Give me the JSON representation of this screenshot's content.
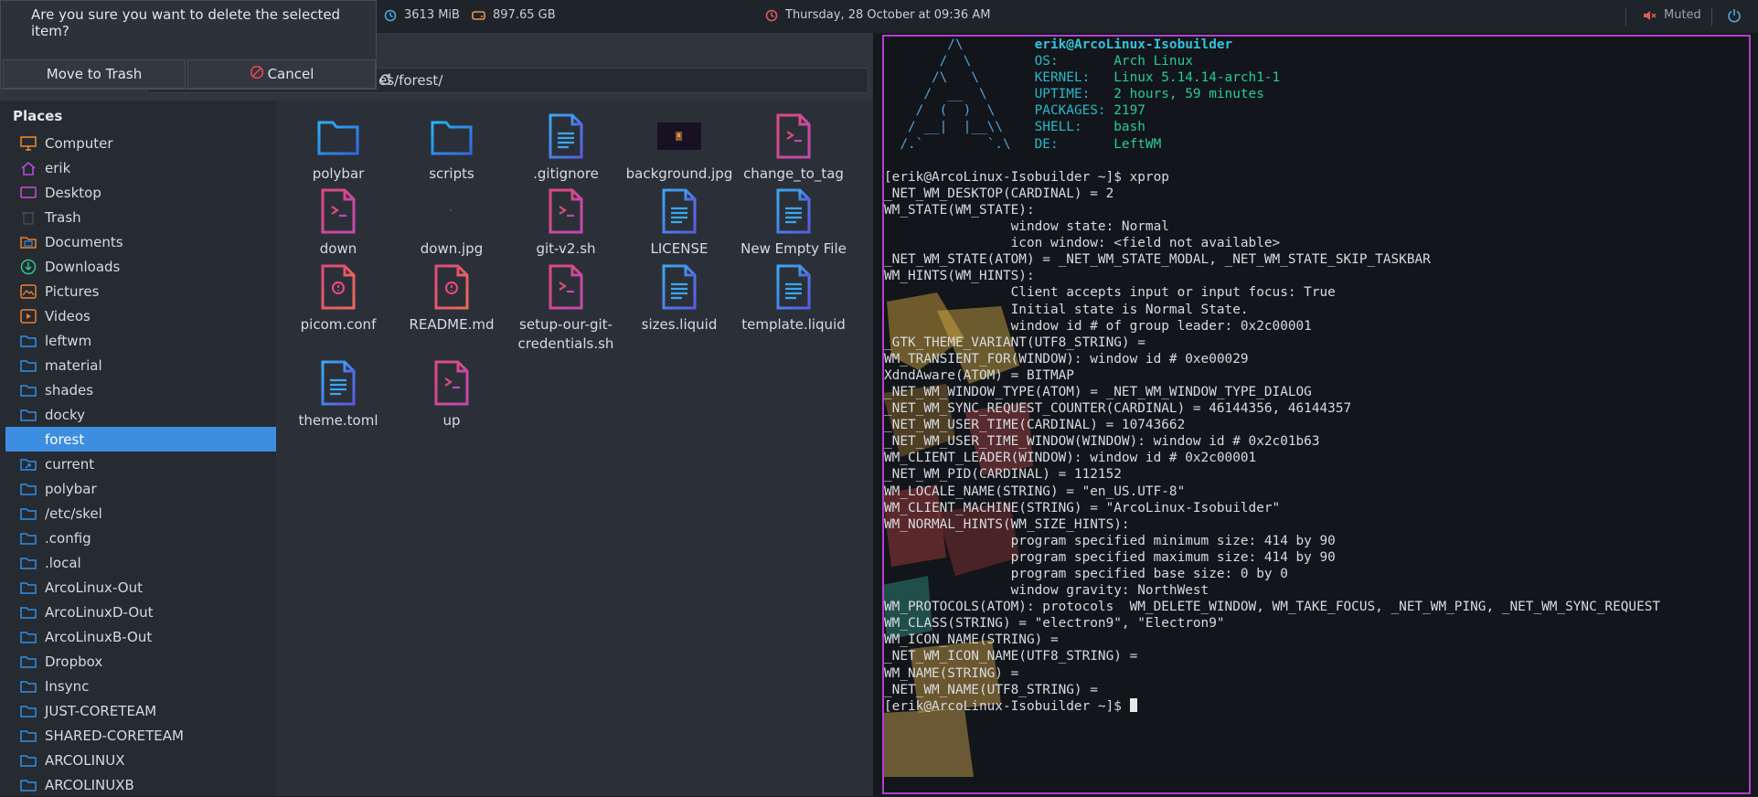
{
  "topbar": {
    "memory": "3613 MiB",
    "disk": "897.65 GB",
    "datetime": "Thursday, 28 October at 09:36 AM",
    "volume": "Muted",
    "colors": {
      "accent_red": "#e05a5a",
      "accent_blue": "#4fa6d8",
      "accent_orange": "#e8974a"
    }
  },
  "dialog": {
    "question": "Are you sure you want to delete the selected item?",
    "move_to_trash": "Move to Trash",
    "cancel": "Cancel"
  },
  "file_manager": {
    "path_visible": "es/forest/",
    "places_title": "Places",
    "places": [
      {
        "label": "Computer",
        "icon": "computer-icon"
      },
      {
        "label": "erik",
        "icon": "home-icon"
      },
      {
        "label": "Desktop",
        "icon": "desktop-icon"
      },
      {
        "label": "Trash",
        "icon": "trash-icon"
      },
      {
        "label": "Documents",
        "icon": "documents-icon"
      },
      {
        "label": "Downloads",
        "icon": "downloads-icon"
      },
      {
        "label": "Pictures",
        "icon": "pictures-icon"
      },
      {
        "label": "Videos",
        "icon": "videos-icon"
      },
      {
        "label": "leftwm",
        "icon": "folder-icon"
      },
      {
        "label": "material",
        "icon": "folder-icon"
      },
      {
        "label": "shades",
        "icon": "folder-icon"
      },
      {
        "label": "docky",
        "icon": "folder-icon"
      },
      {
        "label": "forest",
        "icon": "folder-icon",
        "selected": true
      },
      {
        "label": "current",
        "icon": "folder-link-icon"
      },
      {
        "label": "polybar",
        "icon": "folder-icon"
      },
      {
        "label": "/etc/skel",
        "icon": "folder-icon"
      },
      {
        "label": ".config",
        "icon": "folder-icon"
      },
      {
        "label": ".local",
        "icon": "folder-icon"
      },
      {
        "label": "ArcoLinux-Out",
        "icon": "folder-icon"
      },
      {
        "label": "ArcoLinuxD-Out",
        "icon": "folder-icon"
      },
      {
        "label": "ArcoLinuxB-Out",
        "icon": "folder-icon"
      },
      {
        "label": "Dropbox",
        "icon": "folder-icon"
      },
      {
        "label": "Insync",
        "icon": "folder-icon"
      },
      {
        "label": "JUST-CORETEAM",
        "icon": "folder-icon"
      },
      {
        "label": "SHARED-CORETEAM",
        "icon": "folder-icon"
      },
      {
        "label": "ARCOLINUX",
        "icon": "folder-icon"
      },
      {
        "label": "ARCOLINUXB",
        "icon": "folder-icon"
      }
    ],
    "files": [
      {
        "name": "polybar",
        "type": "folder"
      },
      {
        "name": "scripts",
        "type": "folder"
      },
      {
        "name": ".gitignore",
        "type": "text"
      },
      {
        "name": "background.jpg",
        "type": "image"
      },
      {
        "name": "change_to_tag",
        "type": "script"
      },
      {
        "name": "down",
        "type": "script"
      },
      {
        "name": "down.jpg",
        "type": "image-blank"
      },
      {
        "name": "git-v2.sh",
        "type": "script"
      },
      {
        "name": "LICENSE",
        "type": "text"
      },
      {
        "name": "New Empty File",
        "type": "text"
      },
      {
        "name": "picom.conf",
        "type": "config"
      },
      {
        "name": "README.md",
        "type": "config"
      },
      {
        "name": "setup-our-git-credentials.sh",
        "label_lines": [
          "setup-our-git-",
          "credentials.sh"
        ],
        "type": "script"
      },
      {
        "name": "sizes.liquid",
        "type": "text"
      },
      {
        "name": "template.liquid",
        "type": "text"
      },
      {
        "name": "theme.toml",
        "type": "text"
      },
      {
        "name": "up",
        "type": "script"
      }
    ]
  },
  "terminal": {
    "neofetch": {
      "user_host": "erik@ArcoLinux-Isobuilder",
      "rows": [
        {
          "key": "OS:",
          "value": "Arch Linux"
        },
        {
          "key": "KERNEL:",
          "value": "Linux 5.14.14-arch1-1"
        },
        {
          "key": "UPTIME:",
          "value": "2 hours, 59 minutes"
        },
        {
          "key": "PACKAGES:",
          "value": "2197"
        },
        {
          "key": "SHELL:",
          "value": "bash"
        },
        {
          "key": "DE:",
          "value": "LeftWM"
        }
      ]
    },
    "lines": [
      "[erik@ArcoLinux-Isobuilder ~]$ xprop",
      "_NET_WM_DESKTOP(CARDINAL) = 2",
      "WM_STATE(WM_STATE):",
      "                window state: Normal",
      "                icon window: <field not available>",
      "_NET_WM_STATE(ATOM) = _NET_WM_STATE_MODAL, _NET_WM_STATE_SKIP_TASKBAR",
      "WM_HINTS(WM_HINTS):",
      "                Client accepts input or input focus: True",
      "                Initial state is Normal State.",
      "                window id # of group leader: 0x2c00001",
      "_GTK_THEME_VARIANT(UTF8_STRING) =",
      "WM_TRANSIENT_FOR(WINDOW): window id # 0xe00029",
      "XdndAware(ATOM) = BITMAP",
      "_NET_WM_WINDOW_TYPE(ATOM) = _NET_WM_WINDOW_TYPE_DIALOG",
      "_NET_WM_SYNC_REQUEST_COUNTER(CARDINAL) = 46144356, 46144357",
      "_NET_WM_USER_TIME(CARDINAL) = 10743662",
      "_NET_WM_USER_TIME_WINDOW(WINDOW): window id # 0x2c01b63",
      "WM_CLIENT_LEADER(WINDOW): window id # 0x2c00001",
      "_NET_WM_PID(CARDINAL) = 112152",
      "WM_LOCALE_NAME(STRING) = \"en_US.UTF-8\"",
      "WM_CLIENT_MACHINE(STRING) = \"ArcoLinux-Isobuilder\"",
      "WM_NORMAL_HINTS(WM_SIZE_HINTS):",
      "                program specified minimum size: 414 by 90",
      "                program specified maximum size: 414 by 90",
      "                program specified base size: 0 by 0",
      "                window gravity: NorthWest",
      "WM_PROTOCOLS(ATOM): protocols  WM_DELETE_WINDOW, WM_TAKE_FOCUS, _NET_WM_PING, _NET_WM_SYNC_REQUEST",
      "WM_CLASS(STRING) = \"electron9\", \"Electron9\"",
      "WM_ICON_NAME(STRING) =",
      "_NET_WM_ICON_NAME(UTF8_STRING) =",
      "WM_NAME(STRING) =",
      "_NET_WM_NAME(UTF8_STRING) =",
      "[erik@ArcoLinux-Isobuilder ~]$ "
    ]
  }
}
